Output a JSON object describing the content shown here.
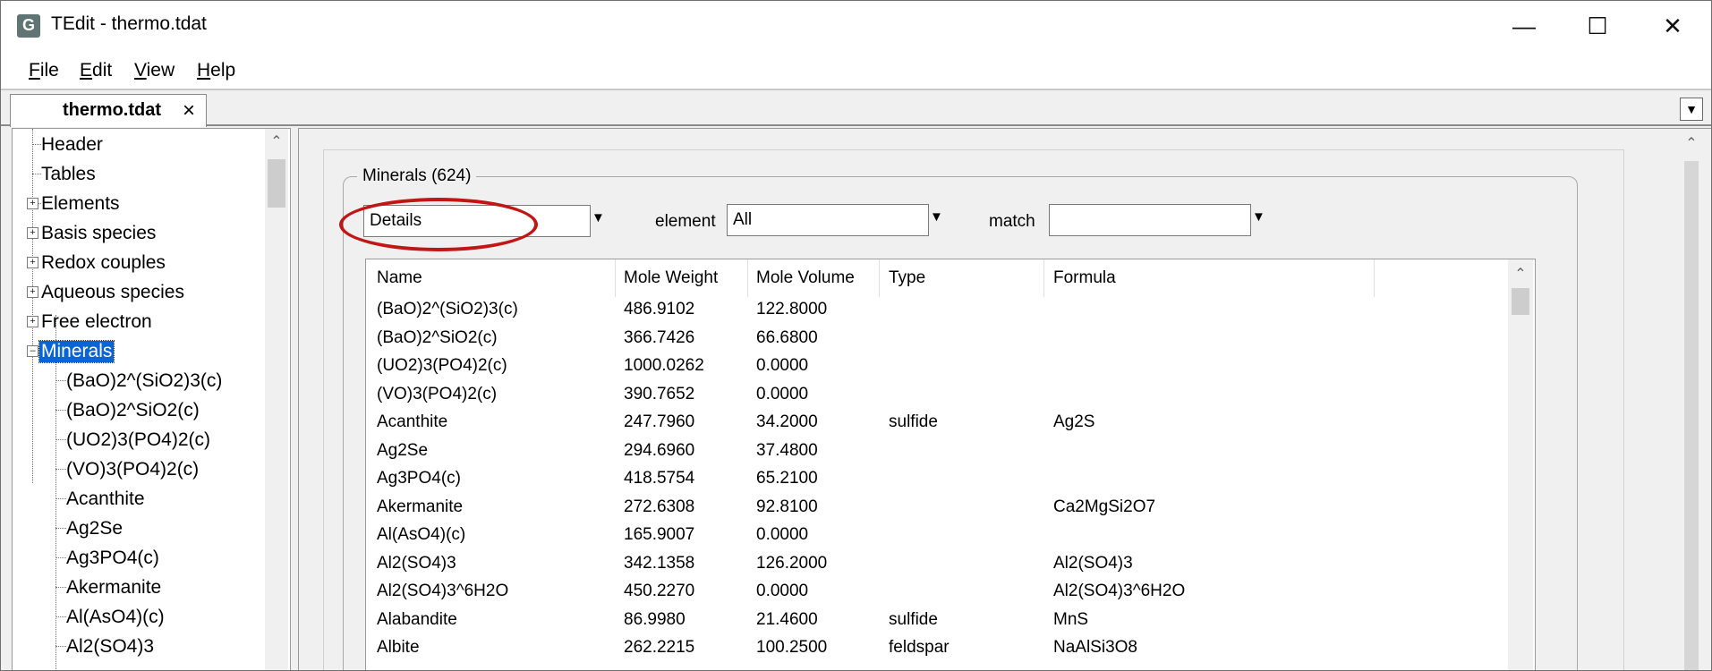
{
  "window": {
    "title": "TEdit - thermo.tdat",
    "app_icon_letter": "G"
  },
  "menu": [
    {
      "key": "F",
      "rest": "ile"
    },
    {
      "key": "E",
      "rest": "dit"
    },
    {
      "key": "V",
      "rest": "iew"
    },
    {
      "key": "H",
      "rest": "elp"
    }
  ],
  "tab": {
    "label": "thermo.tdat",
    "close": "×"
  },
  "tree": {
    "top_items": [
      "Header",
      "Tables",
      "Elements",
      "Basis species",
      "Redox couples",
      "Aqueous species",
      "Free electron",
      "Minerals"
    ],
    "selected": "Minerals",
    "mineral_children": [
      "(BaO)2^(SiO2)3(c)",
      "(BaO)2^SiO2(c)",
      "(UO2)3(PO4)2(c)",
      "(VO)3(PO4)2(c)",
      "Acanthite",
      "Ag2Se",
      "Ag3PO4(c)",
      "Akermanite",
      "Al(AsO4)(c)",
      "Al2(SO4)3"
    ]
  },
  "panel": {
    "group_label": "Minerals (624)",
    "view_select": "Details",
    "element_label": "element",
    "element_select": "All",
    "match_label": "match",
    "match_value": ""
  },
  "table": {
    "columns": [
      "Name",
      "Mole Weight",
      "Mole Volume",
      "Type",
      "Formula"
    ],
    "rows": [
      [
        "(BaO)2^(SiO2)3(c)",
        "486.9102",
        "122.8000",
        "",
        ""
      ],
      [
        "(BaO)2^SiO2(c)",
        "366.7426",
        "66.6800",
        "",
        ""
      ],
      [
        "(UO2)3(PO4)2(c)",
        "1000.0262",
        "0.0000",
        "",
        ""
      ],
      [
        "(VO)3(PO4)2(c)",
        "390.7652",
        "0.0000",
        "",
        ""
      ],
      [
        "Acanthite",
        "247.7960",
        "34.2000",
        "sulfide",
        "Ag2S"
      ],
      [
        "Ag2Se",
        "294.6960",
        "37.4800",
        "",
        ""
      ],
      [
        "Ag3PO4(c)",
        "418.5754",
        "65.2100",
        "",
        ""
      ],
      [
        "Akermanite",
        "272.6308",
        "92.8100",
        "",
        "Ca2MgSi2O7"
      ],
      [
        "Al(AsO4)(c)",
        "165.9007",
        "0.0000",
        "",
        ""
      ],
      [
        "Al2(SO4)3",
        "342.1358",
        "126.2000",
        "",
        "Al2(SO4)3"
      ],
      [
        "Al2(SO4)3^6H2O",
        "450.2270",
        "0.0000",
        "",
        "Al2(SO4)3^6H2O"
      ],
      [
        "Alabandite",
        "86.9980",
        "21.4600",
        "sulfide",
        "MnS"
      ],
      [
        "Albite",
        "262.2215",
        "100.2500",
        "feldspar",
        "NaAlSi3O8"
      ]
    ]
  },
  "colors": {
    "selection": "#0a64d6",
    "highlight_oval": "#c01616"
  }
}
